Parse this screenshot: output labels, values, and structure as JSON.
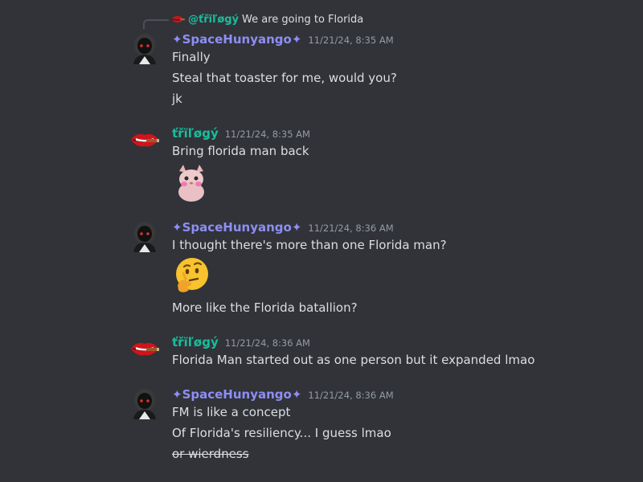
{
  "reply": {
    "author": "@ťřïľøǥý",
    "text": "We are going to Florida"
  },
  "messages": [
    {
      "author": "✦SpaceHunyango✦",
      "time": "11/21/24, 8:35 AM",
      "lines": [
        "Finally",
        "Steal that toaster for me, would you?",
        "jk"
      ]
    },
    {
      "author": "ťřïľøǥý",
      "time": "11/21/24, 8:35 AM",
      "lines": [
        "Bring florida man back"
      ],
      "sticker": "pink-cat-emoji"
    },
    {
      "author": "✦SpaceHunyango✦",
      "time": "11/21/24, 8:36 AM",
      "lines": [
        "I thought there's more than one Florida man?",
        "More like the Florida batallion?"
      ],
      "emoji": "thinking-face-emoji"
    },
    {
      "author": "ťřïľøǥý",
      "time": "11/21/24, 8:36 AM",
      "lines": [
        "Florida Man started out as one person but it expanded lmao"
      ]
    },
    {
      "author": "✦SpaceHunyango✦",
      "time": "11/21/24, 8:36 AM",
      "lines": [
        "FM is like a concept",
        "Of Florida's resiliency... I guess lmao"
      ],
      "struck_line": "or wierdness"
    }
  ],
  "colors": {
    "background": "#313338",
    "space_author": "#8e8ef6",
    "tri_author": "#1abc9c",
    "timestamp": "#949ba4",
    "text": "#dbdee1"
  }
}
